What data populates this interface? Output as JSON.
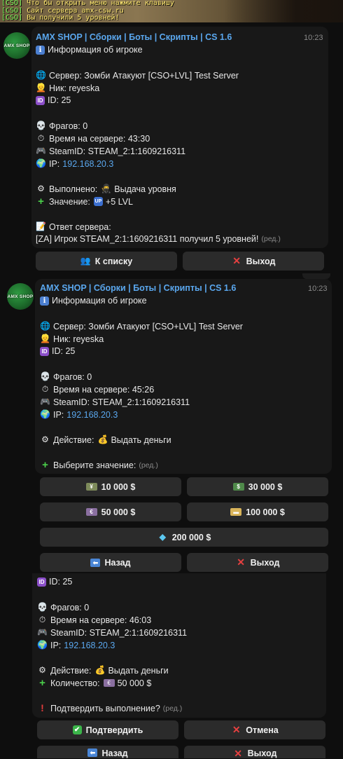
{
  "console": [
    {
      "tag": "[CSO]",
      "text": "Что бы открыть меню нажмите клавишу"
    },
    {
      "tag": "[CSO]",
      "text": "Сайт сервера amx-csw.ru"
    },
    {
      "tag": "[CSO]",
      "text": "Вы получили 5 уровней!"
    }
  ],
  "bot": {
    "name": "AMX SHOP | Сборки | Боты | Скрипты | CS 1.6",
    "avatar_text": "AMX SHOP"
  },
  "msg1": {
    "time": "10:23",
    "title": "Информация об игроке",
    "server": "Сервер: Зомби Атакуют [CSO+LVL] Test Server",
    "nick": "Ник: reyeska",
    "id": "ID: 25",
    "frags": "Фрагов: 0",
    "time_on": "Время на сервере: 43:30",
    "steamid": "SteamID: STEAM_2:1:1609216311",
    "ip_label": "IP: ",
    "ip": "192.168.20.3",
    "done": "Выполнено:",
    "done_action": "Выдача уровня",
    "value_label": "Значение:",
    "value": "+5 LVL",
    "answer_label": "Ответ сервера:",
    "answer": "[ZA] Игрок STEAM_2:1:1609216311 получил 5 уровней!",
    "edited": "(ред.)",
    "btn_list": "К списку",
    "btn_exit": "Выход"
  },
  "msg2": {
    "time": "10:23",
    "title": "Информация об игроке",
    "server": "Сервер: Зомби Атакуют [CSO+LVL] Test Server",
    "nick": "Ник: reyeska",
    "id": "ID: 25",
    "frags": "Фрагов: 0",
    "time_on": "Время на сервере: 45:26",
    "steamid": "SteamID: STEAM_2:1:1609216311",
    "ip_label": "IP: ",
    "ip": "192.168.20.3",
    "action_label": "Действие:",
    "action": "Выдать деньги",
    "choose": "Выберите значение:",
    "edited": "(ред.)",
    "amounts": [
      "10 000 $",
      "30 000 $",
      "50 000 $",
      "100 000 $",
      "200 000 $"
    ],
    "btn_back": "Назад",
    "btn_exit": "Выход"
  },
  "msg3": {
    "id": "ID: 25",
    "frags": "Фрагов: 0",
    "time_on": "Время на сервере: 46:03",
    "steamid": "SteamID: STEAM_2:1:1609216311",
    "ip_label": "IP: ",
    "ip": "192.168.20.3",
    "action_label": "Действие:",
    "action": "Выдать деньги",
    "qty_label": "Количество:",
    "qty": "50 000 $",
    "confirm": "Подтвердить выполнение?",
    "edited": "(ред.)",
    "btn_confirm": "Подтвердить",
    "btn_cancel": "Отмена",
    "btn_back": "Назад",
    "btn_exit": "Выход"
  }
}
